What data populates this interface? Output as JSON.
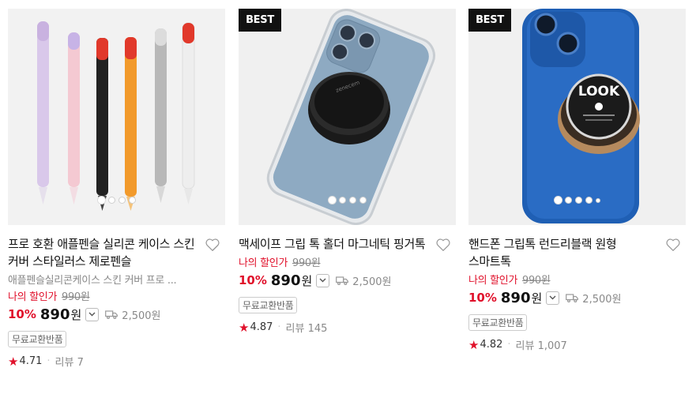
{
  "products": [
    {
      "best": "",
      "title": "프로 호환 애플펜슬 실리콘 케이스 스킨 커버 스타일러스 제로펜슬",
      "subtitle": "애플펜슬실리콘케이스 스킨 커버 프로 ...",
      "my_price_label": "나의 할인가",
      "original_price": "990원",
      "discount": "10%",
      "price": "890",
      "currency": "원",
      "shipping": "2,500원",
      "tag": "무료교환반품",
      "star": "★",
      "rating": "4.71",
      "review_label": "리뷰 7",
      "image_icon": "pencil-cases-image"
    },
    {
      "best": "BEST",
      "title": "맥세이프 그립 톡 홀더 마그네틱 핑거톡",
      "subtitle": "",
      "my_price_label": "나의 할인가",
      "original_price": "990원",
      "discount": "10%",
      "price": "890",
      "currency": "원",
      "shipping": "2,500원",
      "tag": "무료교환반품",
      "star": "★",
      "rating": "4.87",
      "review_label": "리뷰 145",
      "image_icon": "phone-grip-image"
    },
    {
      "best": "BEST",
      "title": "핸드폰 그립톡 런드리블랙 원형 스마트톡",
      "subtitle": "",
      "my_price_label": "나의 할인가",
      "original_price": "990원",
      "discount": "10%",
      "price": "890",
      "currency": "원",
      "shipping": "2,500원",
      "tag": "무료교환반품",
      "star": "★",
      "rating": "4.82",
      "review_label": "리뷰 1,007",
      "image_icon": "look-grip-image",
      "image_text": "LOOK"
    }
  ],
  "colors": {
    "accent": "#e0112b",
    "best_bg": "#111111"
  }
}
